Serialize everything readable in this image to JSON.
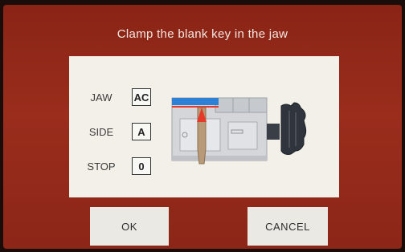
{
  "header": {
    "title": "Clamp the blank key in the jaw"
  },
  "settings": [
    {
      "label": "JAW",
      "value": "AC"
    },
    {
      "label": "SIDE",
      "value": "A"
    },
    {
      "label": "STOP",
      "value": "0"
    }
  ],
  "buttons": {
    "ok_label": "OK",
    "cancel_label": "CANCEL"
  },
  "colors": {
    "background": "#8a2416",
    "panel": "#f2f0e8",
    "jaw_bar": "#2e7fd6",
    "pointer": "#e53a2a",
    "key": "#b89a78"
  }
}
